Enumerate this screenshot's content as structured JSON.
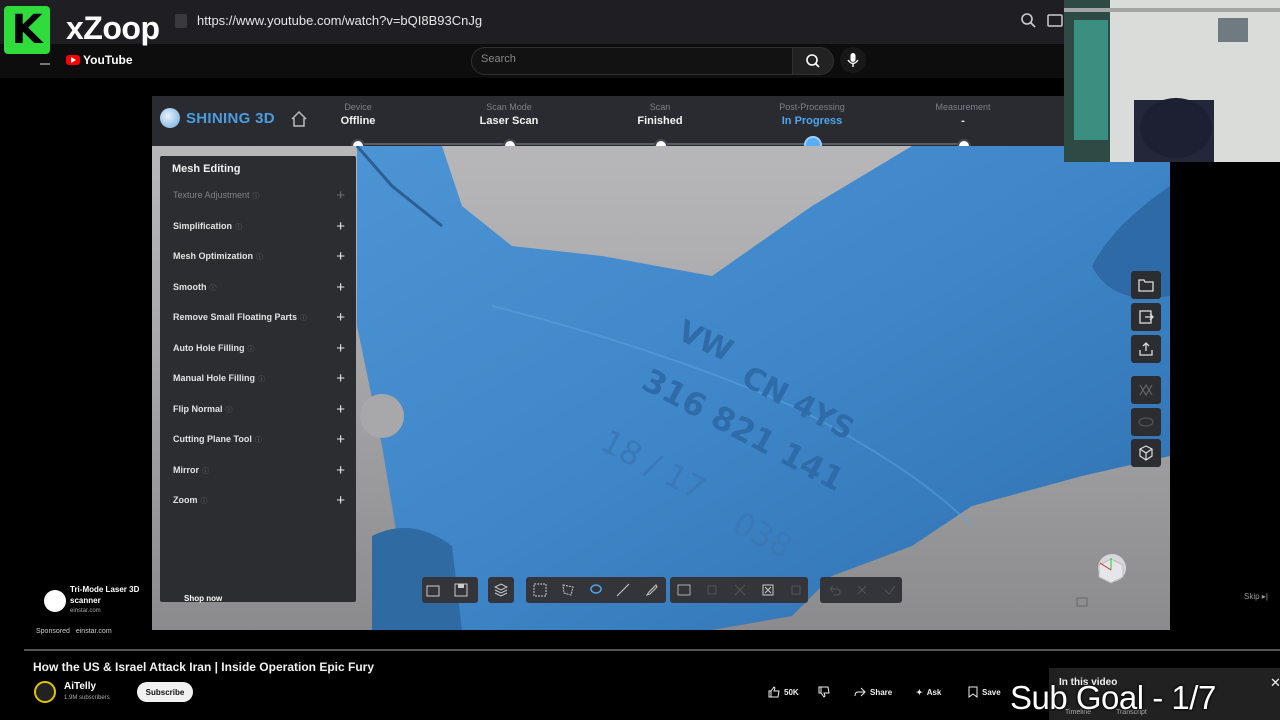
{
  "browser": {
    "url": "https://www.youtube.com/watch?v=bQI8B93CnJg",
    "icons": [
      "zoom-icon",
      "cast-icon"
    ]
  },
  "overlay_brand": {
    "name": "xZoop",
    "logo_letter": "K",
    "youtube_label": "YouTube",
    "accent": "#2fdc3b"
  },
  "yt_header": {
    "search_placeholder": "Search"
  },
  "app": {
    "brand": "SHINING 3D",
    "steps": [
      {
        "label": "Device",
        "value": "Offline",
        "active": false
      },
      {
        "label": "Scan Mode",
        "value": "Laser Scan",
        "active": false
      },
      {
        "label": "Scan",
        "value": "Finished",
        "active": false
      },
      {
        "label": "Post-Processing",
        "value": "In Progress",
        "active": true
      },
      {
        "label": "Measurement",
        "value": "-",
        "active": false
      }
    ],
    "accent": "#4fa6ee",
    "mesh_panel": {
      "title": "Mesh Editing",
      "items": [
        {
          "label": "Texture Adjustment",
          "enabled": false
        },
        {
          "label": "Simplification",
          "enabled": true
        },
        {
          "label": "Mesh Optimization",
          "enabled": true
        },
        {
          "label": "Smooth",
          "enabled": true
        },
        {
          "label": "Remove Small Floating Parts",
          "enabled": true
        },
        {
          "label": "Auto Hole Filling",
          "enabled": true
        },
        {
          "label": "Manual Hole Filling",
          "enabled": true
        },
        {
          "label": "Flip Normal",
          "enabled": true
        },
        {
          "label": "Cutting Plane Tool",
          "enabled": true
        },
        {
          "label": "Mirror",
          "enabled": true
        },
        {
          "label": "Zoom",
          "enabled": true
        }
      ]
    },
    "part_engraving": {
      "line1": "CN 4YS",
      "line2": "316 821 141",
      "line3": "18 / 17",
      "line4": "038",
      "logo": "VW"
    },
    "right_toolbar": [
      "folder-icon",
      "export-icon",
      "share-icon",
      "texture-icon",
      "eye-icon",
      "mesh-view-icon"
    ]
  },
  "ad": {
    "title": "Tri-Mode Laser 3D scanner",
    "domain": "einstar.com",
    "cta": "Shop now",
    "sponsored": "Sponsored",
    "sponsor_domain": "einstar.com",
    "skip": "Skip"
  },
  "video": {
    "progress": 0.0,
    "title": "How the US & Israel Attack Iran | Inside Operation Epic Fury",
    "channel": "AiTelly",
    "subscribers": "1.9M subscribers",
    "subscribe_label": "Subscribe",
    "likes": "50K",
    "share_label": "Share",
    "ask_label": "Ask",
    "save_label": "Save"
  },
  "in_this_video": {
    "title": "In this video",
    "tabs": [
      "Timeline",
      "Transcript"
    ]
  },
  "caption": "Sub Goal - 1/7"
}
